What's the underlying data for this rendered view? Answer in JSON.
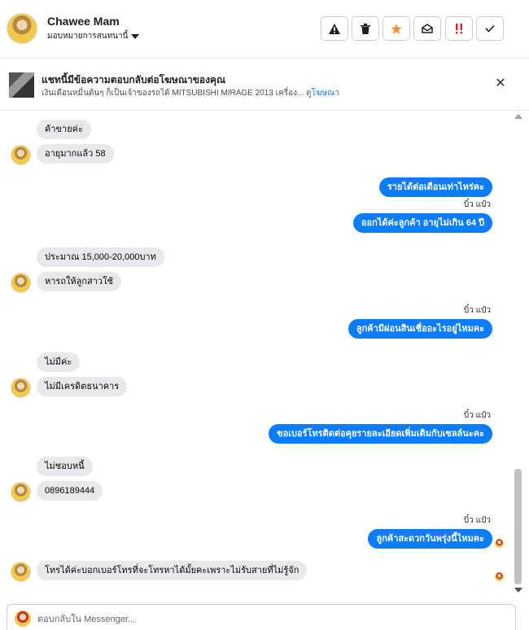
{
  "header": {
    "contact_name": "Chawee Mam",
    "assign_label": "มอบหมายการสนทนานี้",
    "tools": [
      {
        "icon": "warning-icon",
        "glyph": "⚠"
      },
      {
        "icon": "trash-icon",
        "glyph": "🗑"
      },
      {
        "icon": "star-icon",
        "glyph": "★"
      },
      {
        "icon": "open-envelope-icon",
        "glyph": "✉"
      },
      {
        "icon": "priority-icon",
        "glyph": "‼"
      },
      {
        "icon": "check-icon",
        "glyph": "✓"
      }
    ]
  },
  "ad": {
    "title": "แชทนี้มีข้อความตอบกลับต่อโฆษณาของคุณ",
    "subtitle": "เงินเดือนหมื่นต้นๆ ก็เป็นเจ้าของรถได้ MITSUBISHI MIRAGE 2013 เครื่อง...",
    "link": "ดูโฆษณา"
  },
  "messages": [
    {
      "dir": "in",
      "text": "ค้าขายค่ะ"
    },
    {
      "dir": "in",
      "text": "อายุมากแล้ว 58"
    },
    {
      "dir": "out",
      "text": "รายได้ต่อเดือนเท่าไหร่คะ"
    },
    {
      "dir": "sender",
      "text": "บิ๋ว แป๋ว"
    },
    {
      "dir": "out",
      "text": "ออกได้ค่ะลูกค้า อายุไม่เกิน 64 ปี"
    },
    {
      "dir": "in",
      "text": "ประมาณ 15,000-20,000บาท"
    },
    {
      "dir": "in",
      "text": "หารถให้ลูกสาวใช้"
    },
    {
      "dir": "sender",
      "text": "บิ๋ว แป๋ว"
    },
    {
      "dir": "out",
      "text": "ลูกค้ามีผ่อนสินเชื่ออะไรอยู่ไหมคะ"
    },
    {
      "dir": "in",
      "text": "ไม่มีค่ะ"
    },
    {
      "dir": "in",
      "text": "ไม่มีเครดิตธนาคาร"
    },
    {
      "dir": "sender",
      "text": "บิ๋ว แป๋ว"
    },
    {
      "dir": "out",
      "text": "ขอเบอร์โทรติดต่อคุยรายละเอียดเพิ่มเติมกับเซลล์นะคะ"
    },
    {
      "dir": "in",
      "text": "ไม่ชอบหนี้"
    },
    {
      "dir": "in",
      "text": "0896189444"
    },
    {
      "dir": "sender",
      "text": "บิ๋ว แป๋ว"
    },
    {
      "dir": "out",
      "text": "ลูกค้าสะดวกวันพรุ่งนี้ไหมคะ"
    },
    {
      "dir": "in",
      "text": "โทรได้ค่ะบอกเบอร์โทรที่จะโทรหาได้มั้ยคะเพราะไม่รับสายที่ไม่รู้จัก"
    }
  ],
  "composer": {
    "placeholder": "ตอบกลับใน Messenger..."
  },
  "colors": {
    "outgoing_bubble": "#0a7cff",
    "incoming_bubble": "#e9e9eb",
    "star": "#f7923b",
    "link": "#1877f2"
  }
}
